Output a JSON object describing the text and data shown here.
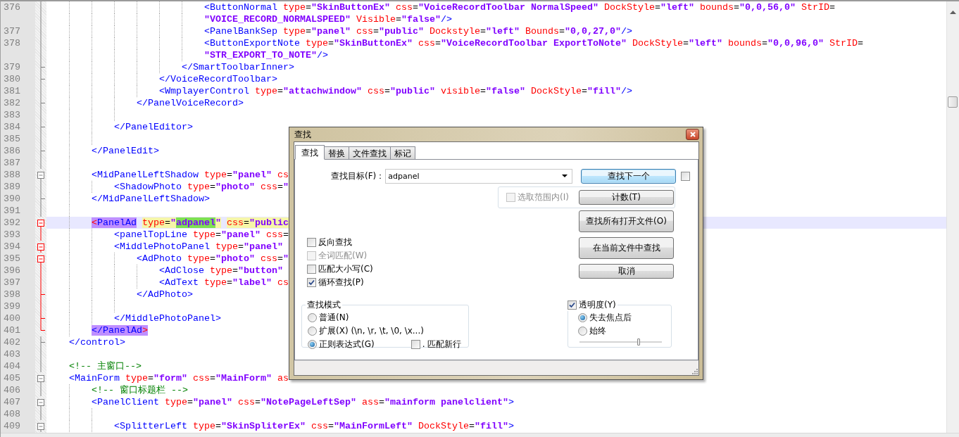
{
  "editor": {
    "lines": [
      {
        "children": [
          {
            "children": [
              {
                "children": [
                  {
                    "children": [
                      {
                        "children": [
                          {
                            "children": [
                              {
                                "number": "376",
                                "kind": "mid",
                                "active": false,
                                "current": false,
                                "segments": [
                                  {
                                    "kind": "tag",
                                    "text": "<ButtonNormal"
                                  },
                                  {
                                    "kind": "attr",
                                    "text": " type"
                                  },
                                  {
                                    "kind": "eq",
                                    "text": "="
                                  },
                                  {
                                    "kind": "val",
                                    "text": "\"SkinButtonEx\""
                                  },
                                  {
                                    "kind": "attr",
                                    "text": " css"
                                  },
                                  {
                                    "kind": "eq",
                                    "text": "="
                                  },
                                  {
                                    "kind": "val",
                                    "text": "\"VoiceRecordToolbar NormalSpeed\""
                                  },
                                  {
                                    "kind": "attr",
                                    "text": " DockStyle"
                                  },
                                  {
                                    "kind": "eq",
                                    "text": "="
                                  },
                                  {
                                    "kind": "val",
                                    "text": "\"left\""
                                  },
                                  {
                                    "kind": "attr",
                                    "text": " bounds"
                                  },
                                  {
                                    "kind": "eq",
                                    "text": "="
                                  },
                                  {
                                    "kind": "val",
                                    "text": "\"0,0,56,0\""
                                  },
                                  {
                                    "kind": "attr",
                                    "text": " StrID"
                                  },
                                  {
                                    "kind": "eq",
                                    "text": "="
                                  }
                                ],
                                "wrapped": [
                                  {
                                    "kind": "val",
                                    "text": "\"VOICE_RECORD_NORMALSPEED\""
                                  },
                                  {
                                    "kind": "attr",
                                    "text": " Visible"
                                  },
                                  {
                                    "kind": "eq",
                                    "text": "="
                                  },
                                  {
                                    "kind": "val",
                                    "text": "\"false\""
                                  },
                                  {
                                    "kind": "tag",
                                    "text": "/>"
                                  }
                                ]
                              },
                              {
                                "number": "377",
                                "kind": "mid",
                                "active": false,
                                "current": false,
                                "segments": [
                                  {
                                    "kind": "tag",
                                    "text": "<PanelBankSep"
                                  },
                                  {
                                    "kind": "attr",
                                    "text": " type"
                                  },
                                  {
                                    "kind": "eq",
                                    "text": "="
                                  },
                                  {
                                    "kind": "val",
                                    "text": "\"panel\""
                                  },
                                  {
                                    "kind": "attr",
                                    "text": " css"
                                  },
                                  {
                                    "kind": "eq",
                                    "text": "="
                                  },
                                  {
                                    "kind": "val",
                                    "text": "\"public\""
                                  },
                                  {
                                    "kind": "attr",
                                    "text": " Dockstyle"
                                  },
                                  {
                                    "kind": "eq",
                                    "text": "="
                                  },
                                  {
                                    "kind": "val",
                                    "text": "\"left\""
                                  },
                                  {
                                    "kind": "attr",
                                    "text": " Bounds"
                                  },
                                  {
                                    "kind": "eq",
                                    "text": "="
                                  },
                                  {
                                    "kind": "val",
                                    "text": "\"0,0,27,0\""
                                  },
                                  {
                                    "kind": "tag",
                                    "text": "/>"
                                  }
                                ]
                              },
                              {
                                "number": "378",
                                "kind": "mid",
                                "active": false,
                                "current": false,
                                "segments": [
                                  {
                                    "kind": "tag",
                                    "text": "<ButtonExportNote"
                                  },
                                  {
                                    "kind": "attr",
                                    "text": " type"
                                  },
                                  {
                                    "kind": "eq",
                                    "text": "="
                                  },
                                  {
                                    "kind": "val",
                                    "text": "\"SkinButtonEx\""
                                  },
                                  {
                                    "kind": "attr",
                                    "text": " css"
                                  },
                                  {
                                    "kind": "eq",
                                    "text": "="
                                  },
                                  {
                                    "kind": "val",
                                    "text": "\"VoiceRecordToolbar ExportToNote\""
                                  },
                                  {
                                    "kind": "attr",
                                    "text": " DockStyle"
                                  },
                                  {
                                    "kind": "eq",
                                    "text": "="
                                  },
                                  {
                                    "kind": "val",
                                    "text": "\"left\""
                                  },
                                  {
                                    "kind": "attr",
                                    "text": " bounds"
                                  },
                                  {
                                    "kind": "eq",
                                    "text": "="
                                  },
                                  {
                                    "kind": "val",
                                    "text": "\"0,0,96,0\""
                                  },
                                  {
                                    "kind": "attr",
                                    "text": " StrID"
                                  },
                                  {
                                    "kind": "eq",
                                    "text": "="
                                  }
                                ],
                                "wrapped": [
                                  {
                                    "kind": "val",
                                    "text": "\"STR_EXPORT_TO_NOTE\""
                                  },
                                  {
                                    "kind": "tag",
                                    "text": "/>"
                                  }
                                ]
                              }
                            ]
                          },
                          {
                            "number": "379",
                            "kind": "tick",
                            "active": false,
                            "current": false,
                            "segments": [
                              {
                                "kind": "tag",
                                "text": "</SmartToolbarInner>"
                              }
                            ]
                          }
                        ]
                      },
                      {
                        "number": "380",
                        "kind": "tick",
                        "active": false,
                        "current": false,
                        "segments": [
                          {
                            "kind": "tag",
                            "text": "</VoiceRecordToolbar>"
                          }
                        ]
                      },
                      {
                        "number": "381",
                        "kind": "mid",
                        "active": false,
                        "current": false,
                        "segments": [
                          {
                            "kind": "tag",
                            "text": "<WmplayerControl"
                          },
                          {
                            "kind": "attr",
                            "text": " type"
                          },
                          {
                            "kind": "eq",
                            "text": "="
                          },
                          {
                            "kind": "val",
                            "text": "\"attachwindow\""
                          },
                          {
                            "kind": "attr",
                            "text": " css"
                          },
                          {
                            "kind": "eq",
                            "text": "="
                          },
                          {
                            "kind": "val",
                            "text": "\"public\""
                          },
                          {
                            "kind": "attr",
                            "text": " visible"
                          },
                          {
                            "kind": "eq",
                            "text": "="
                          },
                          {
                            "kind": "val",
                            "text": "\"false\""
                          },
                          {
                            "kind": "attr",
                            "text": " DockStyle"
                          },
                          {
                            "kind": "eq",
                            "text": "="
                          },
                          {
                            "kind": "val",
                            "text": "\"fill\""
                          },
                          {
                            "kind": "tag",
                            "text": "/>"
                          }
                        ]
                      }
                    ]
                  },
                  {
                    "number": "382",
                    "kind": "tick",
                    "active": false,
                    "current": false,
                    "segments": [
                      {
                        "kind": "tag",
                        "text": "</PanelVoiceRecord>"
                      }
                    ]
                  },
                  {
                    "number": "383",
                    "kind": "mid",
                    "active": false,
                    "current": false
                  }
                ]
              },
              {
                "number": "384",
                "kind": "tick",
                "active": false,
                "current": false,
                "segments": [
                  {
                    "kind": "tag",
                    "text": "</PanelEditor>"
                  }
                ]
              },
              {
                "number": "385",
                "kind": "mid",
                "active": false,
                "current": false
              }
            ]
          },
          {
            "number": "386",
            "kind": "tick",
            "active": false,
            "current": false,
            "segments": [
              {
                "kind": "tag",
                "text": "</PanelEdit>"
              }
            ]
          },
          {
            "number": "387",
            "kind": "mid",
            "active": false,
            "current": false
          },
          {
            "number": "388",
            "kind": "open",
            "active": false,
            "current": false,
            "segments": [
              {
                "kind": "tag",
                "text": "<MidPanelLeftShadow"
              },
              {
                "kind": "attr",
                "text": " type"
              },
              {
                "kind": "eq",
                "text": "="
              },
              {
                "kind": "val",
                "text": "\"panel\""
              },
              {
                "kind": "attr",
                "text": " cs"
              }
            ],
            "children": [
              {
                "number": "389",
                "kind": "mid",
                "active": false,
                "current": false,
                "segments": [
                  {
                    "kind": "tag",
                    "text": "<ShadowPhoto"
                  },
                  {
                    "kind": "attr",
                    "text": " type"
                  },
                  {
                    "kind": "eq",
                    "text": "="
                  },
                  {
                    "kind": "val",
                    "text": "\"photo\""
                  },
                  {
                    "kind": "attr",
                    "text": " css"
                  },
                  {
                    "kind": "eq",
                    "text": "="
                  },
                  {
                    "kind": "val",
                    "text": "\""
                  }
                ]
              }
            ]
          },
          {
            "number": "390",
            "kind": "tick",
            "active": false,
            "current": false,
            "segments": [
              {
                "kind": "tag",
                "text": "</MidPanelLeftShadow>"
              }
            ]
          },
          {
            "number": "391",
            "kind": "mid",
            "active": false,
            "current": false
          },
          {
            "number": "392",
            "kind": "open",
            "active": true,
            "current": true,
            "segments": [
              {
                "kind": "brace",
                "text": "<",
                "tag_match": true
              },
              {
                "kind": "tag",
                "text": "PanelAd",
                "tag_match": true
              },
              {
                "kind": "attr",
                "text": "type",
                "marked": true,
                "space_before": true
              },
              {
                "kind": "eq",
                "text": "=",
                "marked": true
              },
              {
                "kind": "val",
                "text": "\"",
                "marked": true
              },
              {
                "kind": "val",
                "text": "adpanel",
                "found": true
              },
              {
                "kind": "val",
                "text": "\"",
                "marked": true
              },
              {
                "kind": "attr",
                "text": "css",
                "marked": true,
                "space_before": true
              },
              {
                "kind": "eq",
                "text": "=",
                "marked": true
              },
              {
                "kind": "val",
                "text": "\"public",
                "marked": true
              }
            ],
            "children": [
              {
                "number": "393",
                "kind": "mid",
                "active": true,
                "current": false,
                "segments": [
                  {
                    "kind": "tag",
                    "text": "<panelTopLine"
                  },
                  {
                    "kind": "attr",
                    "text": " type"
                  },
                  {
                    "kind": "eq",
                    "text": "="
                  },
                  {
                    "kind": "val",
                    "text": "\"panel\""
                  },
                  {
                    "kind": "attr",
                    "text": " css"
                  },
                  {
                    "kind": "eq",
                    "text": "="
                  }
                ]
              },
              {
                "number": "394",
                "kind": "open",
                "active": true,
                "current": false,
                "segments": [
                  {
                    "kind": "tag",
                    "text": "<MiddlePhotoPanel"
                  },
                  {
                    "kind": "attr",
                    "text": " type"
                  },
                  {
                    "kind": "eq",
                    "text": "="
                  },
                  {
                    "kind": "val",
                    "text": "\"panel\""
                  }
                ],
                "children": [
                  {
                    "number": "395",
                    "kind": "open",
                    "active": true,
                    "current": false,
                    "segments": [
                      {
                        "kind": "tag",
                        "text": "<AdPhoto"
                      },
                      {
                        "kind": "attr",
                        "text": " type"
                      },
                      {
                        "kind": "eq",
                        "text": "="
                      },
                      {
                        "kind": "val",
                        "text": "\"photo\""
                      },
                      {
                        "kind": "attr",
                        "text": " css"
                      },
                      {
                        "kind": "eq",
                        "text": "="
                      },
                      {
                        "kind": "val",
                        "text": "\""
                      }
                    ],
                    "children": [
                      {
                        "number": "396",
                        "kind": "mid",
                        "active": true,
                        "current": false,
                        "segments": [
                          {
                            "kind": "tag",
                            "text": "<AdClose"
                          },
                          {
                            "kind": "attr",
                            "text": " type"
                          },
                          {
                            "kind": "eq",
                            "text": "="
                          },
                          {
                            "kind": "val",
                            "text": "\"button\""
                          }
                        ]
                      },
                      {
                        "number": "397",
                        "kind": "mid",
                        "active": true,
                        "current": false,
                        "segments": [
                          {
                            "kind": "tag",
                            "text": "<AdText"
                          },
                          {
                            "kind": "attr",
                            "text": " type"
                          },
                          {
                            "kind": "eq",
                            "text": "="
                          },
                          {
                            "kind": "val",
                            "text": "\"label\""
                          },
                          {
                            "kind": "attr",
                            "text": " cs"
                          }
                        ]
                      }
                    ]
                  },
                  {
                    "number": "398",
                    "kind": "tick",
                    "active": true,
                    "current": false,
                    "segments": [
                      {
                        "kind": "tag",
                        "text": "</AdPhoto>"
                      }
                    ]
                  },
                  {
                    "number": "399",
                    "kind": "mid",
                    "active": true,
                    "current": false
                  }
                ]
              },
              {
                "number": "400",
                "kind": "tick",
                "active": true,
                "current": false,
                "segments": [
                  {
                    "kind": "tag",
                    "text": "</MiddlePhotoPanel>"
                  }
                ]
              }
            ]
          },
          {
            "number": "401",
            "kind": "end",
            "active": true,
            "current": false,
            "segments": [
              {
                "kind": "tag",
                "text": "</PanelAd",
                "tag_match": true
              },
              {
                "kind": "brace",
                "text": ">",
                "tag_match": true
              }
            ]
          }
        ]
      },
      {
        "number": "402",
        "kind": "tick",
        "active": false,
        "current": false,
        "segments": [
          {
            "kind": "tag",
            "text": "</control>"
          }
        ]
      },
      {
        "number": "403",
        "kind": "mid",
        "active": false,
        "current": false
      },
      {
        "number": "404",
        "kind": "mid",
        "active": false,
        "current": false,
        "segments": [
          {
            "kind": "comment",
            "text": "<!-- 主窗口-->"
          }
        ]
      },
      {
        "number": "405",
        "kind": "open",
        "active": false,
        "current": false,
        "segments": [
          {
            "kind": "tag",
            "text": "<MainForm"
          },
          {
            "kind": "attr",
            "text": " type"
          },
          {
            "kind": "eq",
            "text": "="
          },
          {
            "kind": "val",
            "text": "\"form\""
          },
          {
            "kind": "attr",
            "text": " css"
          },
          {
            "kind": "eq",
            "text": "="
          },
          {
            "kind": "val",
            "text": "\"MainForm\""
          },
          {
            "kind": "attr",
            "text": " as"
          }
        ],
        "children": [
          {
            "number": "406",
            "kind": "mid",
            "active": false,
            "current": false,
            "segments": [
              {
                "kind": "comment",
                "text": "<!-- 窗口标题栏 -->"
              }
            ]
          },
          {
            "number": "407",
            "kind": "open",
            "active": false,
            "current": false,
            "segments": [
              {
                "kind": "tag",
                "text": "<PanelClient"
              },
              {
                "kind": "attr",
                "text": " type"
              },
              {
                "kind": "eq",
                "text": "="
              },
              {
                "kind": "val",
                "text": "\"panel\""
              },
              {
                "kind": "attr",
                "text": " css"
              },
              {
                "kind": "eq",
                "text": "="
              },
              {
                "kind": "val",
                "text": "\"NotePageLeftSep\""
              },
              {
                "kind": "attr",
                "text": " ass"
              },
              {
                "kind": "eq",
                "text": "="
              },
              {
                "kind": "val",
                "text": "\"mainform panelclient\""
              },
              {
                "kind": "tag",
                "text": ">"
              }
            ],
            "children": [
              {
                "number": "408",
                "kind": "mid",
                "active": false,
                "current": false
              },
              {
                "number": "409",
                "kind": "open",
                "active": false,
                "current": false,
                "segments": [
                  {
                    "kind": "tag",
                    "text": "<SplitterLeft"
                  },
                  {
                    "kind": "attr",
                    "text": " type"
                  },
                  {
                    "kind": "eq",
                    "text": "="
                  },
                  {
                    "kind": "val",
                    "text": "\"SkinSpliterEx\""
                  },
                  {
                    "kind": "attr",
                    "text": " css"
                  },
                  {
                    "kind": "eq",
                    "text": "="
                  },
                  {
                    "kind": "val",
                    "text": "\"MainFormLeft\""
                  },
                  {
                    "kind": "attr",
                    "text": " DockStyle"
                  },
                  {
                    "kind": "eq",
                    "text": "="
                  },
                  {
                    "kind": "val",
                    "text": "\"fill\""
                  },
                  {
                    "kind": "tag",
                    "text": ">"
                  }
                ]
              }
            ]
          }
        ]
      }
    ]
  },
  "dialog": {
    "title": "查找",
    "tabs": [
      {
        "label": "查找",
        "selected": true
      },
      {
        "label": "替换",
        "selected": false
      },
      {
        "label": "文件查找",
        "selected": false
      },
      {
        "label": "标记",
        "selected": false
      }
    ],
    "find_what": {
      "label": "查找目标(F)：",
      "value": "adpanel"
    },
    "find_next_button": {
      "label": "查找下一个",
      "focused": true
    },
    "side_checkbox": {
      "checked": false
    },
    "in_selection": {
      "label": "选取范围内(I)",
      "checked": false,
      "disabled": true
    },
    "count_button": {
      "label": "计数(T)",
      "focused": false
    },
    "buttons": [
      {
        "label": "查找所有打开文件(O)",
        "focused": false
      },
      {
        "label": "在当前文件中查找",
        "focused": false
      },
      {
        "label": "取消",
        "focused": false
      }
    ],
    "options": [
      {
        "label": "反向查找",
        "checked": false,
        "disabled": false
      },
      {
        "label": "全词匹配(W)",
        "checked": false,
        "disabled": true
      },
      {
        "label": "匹配大小写(C)",
        "checked": false,
        "disabled": false
      },
      {
        "label": "循环查找(P)",
        "checked": true,
        "disabled": false
      }
    ],
    "search_mode": {
      "title": "查找模式",
      "options": [
        {
          "label": "普通(N)",
          "selected": false
        },
        {
          "label": "扩展(X) (\\n, \\r, \\t, \\0, \\x...)",
          "selected": false
        },
        {
          "label": "正则表达式(G)",
          "selected": true
        }
      ],
      "dot_matches_newline": {
        "label": ". 匹配新行",
        "checked": false
      }
    },
    "transparency": {
      "label": "透明度(Y)",
      "checked": true,
      "options": [
        {
          "label": "失去焦点后",
          "selected": true
        },
        {
          "label": "始终",
          "selected": false
        }
      ],
      "level": 0.72
    }
  }
}
